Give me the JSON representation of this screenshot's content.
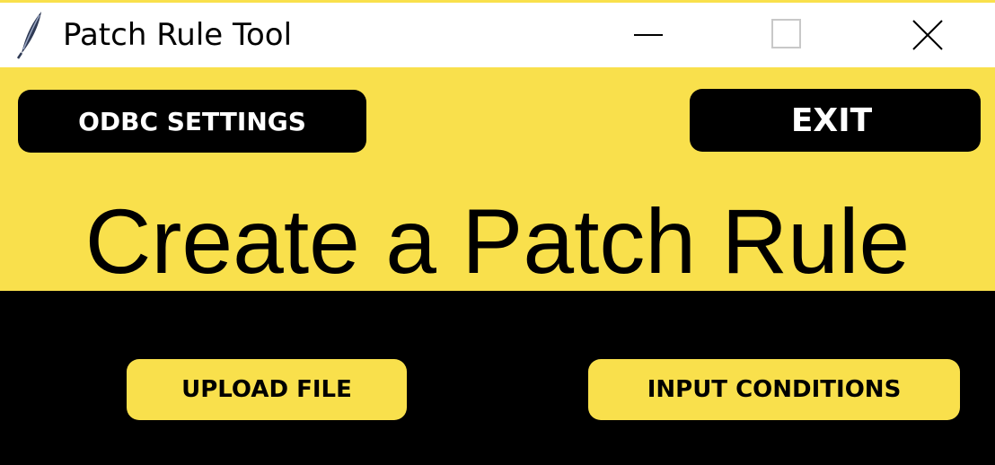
{
  "window": {
    "title": "Patch Rule Tool",
    "icon": "feather-icon",
    "controls": {
      "minimize": "minimize-icon",
      "maximize": "maximize-icon",
      "close": "close-icon"
    }
  },
  "header": {
    "odbc_label": "ODBC SETTINGS",
    "exit_label": "EXIT"
  },
  "main": {
    "heading": "Create a Patch Rule",
    "upload_label": "UPLOAD FILE",
    "conditions_label": "INPUT CONDITIONS"
  },
  "colors": {
    "accent": "#f9e04c",
    "dark": "#000000",
    "titlebar": "#ffffff",
    "dark_button_text": "#ffffff"
  }
}
